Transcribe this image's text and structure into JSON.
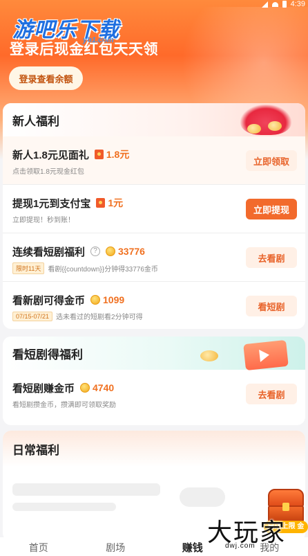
{
  "status_bar": {
    "time": "4:39"
  },
  "hero": {
    "logo": "游吧乐下载",
    "logo_sub": "yb1.com",
    "title": "登录后现金红包天天领",
    "balance_button": "登录查看余额"
  },
  "newbie": {
    "title": "新人福利",
    "items": [
      {
        "title": "新人1.8元见面礼",
        "amount": "1.8元",
        "subtitle": "点击领取1.8元现金红包",
        "action": "立即领取"
      },
      {
        "title": "提现1元到支付宝",
        "amount": "1元",
        "subtitle": "立即提现！秒到账！",
        "action": "立即提现"
      },
      {
        "title": "连续看短剧福利",
        "amount": "33776",
        "tag": "限时11天",
        "subtitle": "看剧{{countdown}}分钟得33776金币",
        "action": "去看剧"
      },
      {
        "title": "看新剧可得金币",
        "amount": "1099",
        "tag": "07/15-07/21",
        "subtitle": "选未看过的短剧看2分钟可得",
        "action": "看短剧"
      }
    ]
  },
  "drama": {
    "title": "看短剧得福利",
    "items": [
      {
        "title": "看短剧赚金币",
        "amount": "4740",
        "subtitle": "看短剧攒金币，攒满即可领取奖励",
        "action": "去看剧"
      }
    ]
  },
  "daily": {
    "title": "日常福利"
  },
  "chest": {
    "label": "已达上限 金"
  },
  "tabbar": {
    "tabs": [
      "首页",
      "剧场",
      "赚钱",
      "我的"
    ],
    "active": "赚钱"
  },
  "watermark": {
    "text": "大玩家",
    "small": "dwj.com"
  },
  "colors": {
    "accent": "#f26a2c",
    "coin": "#f07020",
    "hero": "#ff7a35"
  }
}
